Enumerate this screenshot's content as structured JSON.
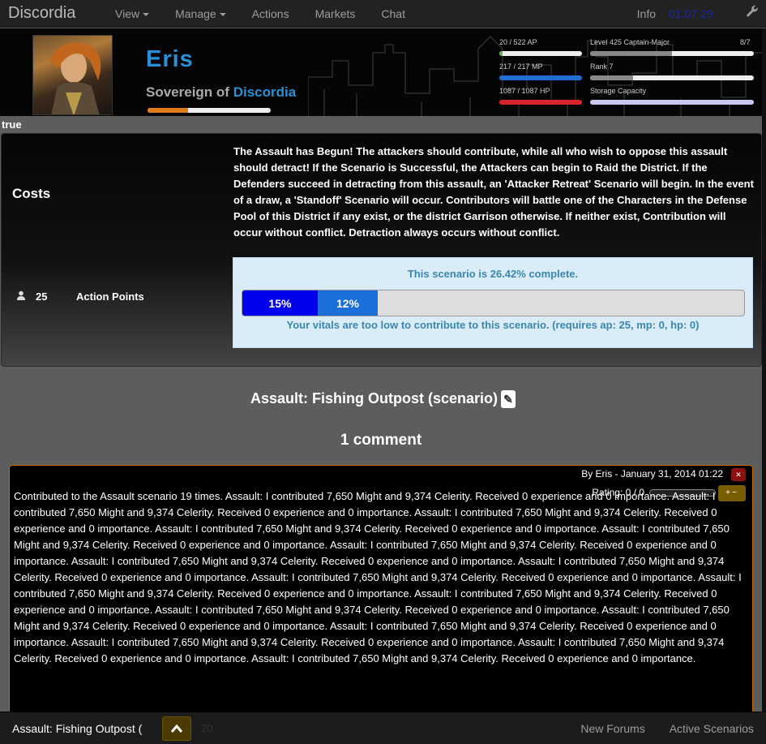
{
  "nav": {
    "brand": "Discordia",
    "items": [
      {
        "label": "View",
        "dropdown": true
      },
      {
        "label": "Manage",
        "dropdown": true
      },
      {
        "label": "Actions",
        "dropdown": false
      },
      {
        "label": "Markets",
        "dropdown": false
      },
      {
        "label": "Chat",
        "dropdown": false
      }
    ],
    "info": "Info",
    "clock": "01:07:29"
  },
  "character": {
    "name": "Eris",
    "title_prefix": "Sovereign of ",
    "realm": "Discordia",
    "xp_progress": 0.33,
    "stats": {
      "ap": {
        "text": "20 / 522 AP",
        "fraction": 0.038,
        "color": "#5cb85c"
      },
      "mp": {
        "text": "217 / 217 MP",
        "fraction": 1.0,
        "color": "#1f6fd4"
      },
      "hp": {
        "text": "1087 / 1087 HP",
        "fraction": 1.0,
        "color": "#d9232a"
      },
      "level": {
        "text": "Level 425 Captain-Major",
        "extra": "8/7",
        "fraction": 0.5,
        "color": "#888"
      },
      "rank": {
        "text": "Rank 7",
        "fraction": 0.26,
        "color": "#888"
      },
      "storage": {
        "text": "Storage Capacity",
        "fraction": 0.0,
        "color": "#c9c6f0"
      }
    }
  },
  "status_label": "true",
  "costs": {
    "heading": "Costs",
    "amount": "25",
    "unit": "Action Points"
  },
  "scenario": {
    "description": "The Assault has Begun! The attackers should contribute, while all who wish to oppose this assault should detract! If the Scenario is Successful, the Attackers can begin to Raid the District. If the Defenders succeed in detracting from this assault, an 'Attacker Retreat' Scenario will begin. In the event of a draw, a 'Standoff' Scenario will occur. Contributors will battle one of the Characters in the Defense Pool of this District if any exist, or the district Garrison otherwise. If neither exist, Contribution will occur without conflict. Detraction always occurs without conflict.",
    "complete_text": "This scenario is 26.42% complete.",
    "segments": [
      {
        "label": "15%",
        "value": 15,
        "color": "#0000ee"
      },
      {
        "label": "12%",
        "value": 12,
        "color": "#1a6fd8"
      }
    ],
    "vitals_text": "Your vitals are too low to contribute to this scenario. (requires ap: 25, mp: 0, hp: 0)",
    "title": "Assault: Fishing Outpost (scenario)"
  },
  "comments": {
    "heading": "1 comment",
    "items": [
      {
        "meta": "By Eris - January 31, 2014 01:22",
        "rating": "Rating: 0 / 0",
        "body": "Contributed to the Assault scenario 19 times. Assault: I contributed 7,650 Might and 9,374 Celerity. Received 0 experience and 0 importance. Assault: I contributed 7,650 Might and 9,374 Celerity. Received 0 experience and 0 importance. Assault: I contributed 7,650 Might and 9,374 Celerity. Received 0 experience and 0 importance. Assault: I contributed 7,650 Might and 9,374 Celerity. Received 0 experience and 0 importance. Assault: I contributed 7,650 Might and 9,374 Celerity. Received 0 experience and 0 importance. Assault: I contributed 7,650 Might and 9,374 Celerity. Received 0 experience and 0 importance. Assault: I contributed 7,650 Might and 9,374 Celerity. Received 0 experience and 0 importance. Assault: I contributed 7,650 Might and 9,374 Celerity. Received 0 experience and 0 importance. Assault: I contributed 7,650 Might and 9,374 Celerity. Received 0 experience and 0 importance. Assault: I contributed 7,650 Might and 9,374 Celerity. Received 0 experience and 0 importance. Assault: I contributed 7,650 Might and 9,374 Celerity. Received 0 experience and 0 importance. Assault: I contributed 7,650 Might and 9,374 Celerity. Received 0 experience and 0 importance. Assault: I contributed 7,650 Might and 9,374 Celerity. Received 0 experience and 0 importance. Assault: I contributed 7,650 Might and 9,374 Celerity. Received 0 experience and 0 importance. Assault: I contributed 7,650 Might and 9,374 Celerity. Received 0 experience and 0 importance. Assault: I contributed 7,650 Might and 9,374 Celerity. Received 0 experience and 0 importance. Assault: I contributed 7,650 Might and 9,374 Celerity. Received 0 experience and 0 importance."
      }
    ]
  },
  "footer": {
    "left_title": "Assault: Fishing Outpost (",
    "faint": "20",
    "links": [
      "New Forums",
      "Active Scenarios"
    ]
  }
}
